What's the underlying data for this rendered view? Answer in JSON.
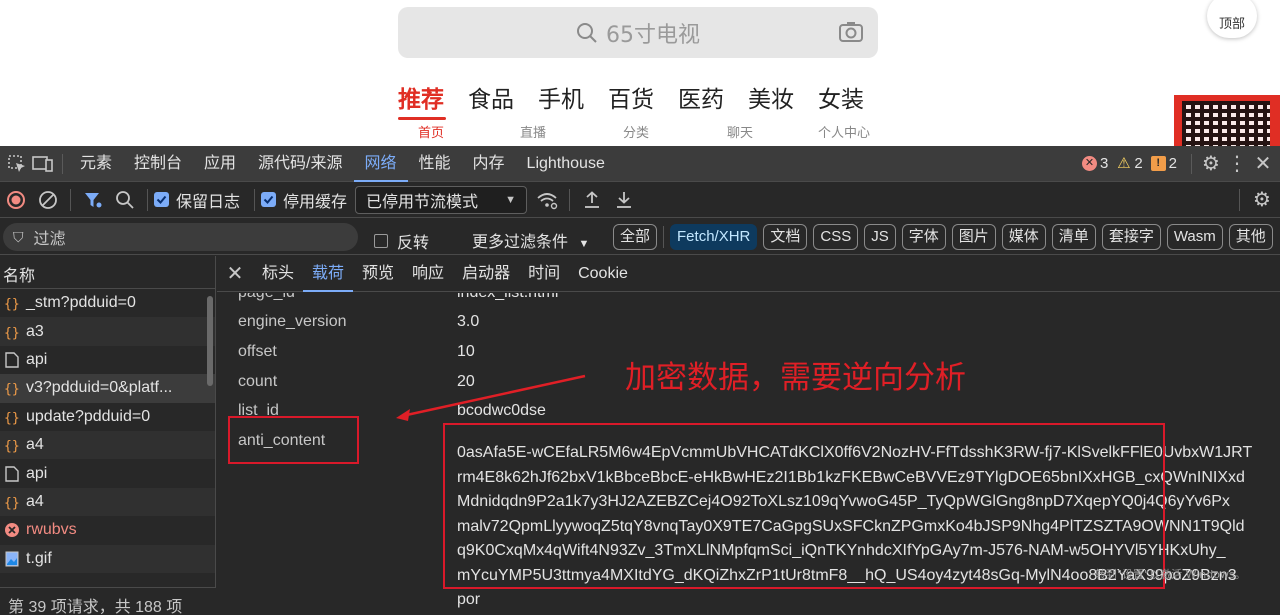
{
  "webpage": {
    "search_placeholder": "65寸电视",
    "categories": [
      "推荐",
      "食品",
      "手机",
      "百货",
      "医药",
      "美妆",
      "女装"
    ],
    "bottom_tabs": [
      "首页",
      "直播",
      "分类",
      "聊天",
      "个人中心"
    ],
    "to_top_label": "顶部"
  },
  "devtools": {
    "main_tabs": [
      "元素",
      "控制台",
      "应用",
      "源代码/来源",
      "网络",
      "性能",
      "内存",
      "Lighthouse"
    ],
    "active_main_tab": "网络",
    "errors": "3",
    "warnings": "2",
    "issues": "2",
    "preserve_log_label": "保留日志",
    "disable_cache_label": "停用缓存",
    "throttle_value": "已停用节流模式",
    "filter_placeholder": "过滤",
    "invert_label": "反转",
    "more_filters_label": "更多过滤条件",
    "type_filters": [
      "全部",
      "Fetch/XHR",
      "文档",
      "CSS",
      "JS",
      "字体",
      "图片",
      "媒体",
      "清单",
      "套接字",
      "Wasm",
      "其他"
    ],
    "active_type_filter": "Fetch/XHR",
    "colors": {
      "accent": "#7cacf8",
      "error": "#f28b82",
      "annotation_red": "#e01f26"
    }
  },
  "request_list": {
    "header": "名称",
    "items": [
      {
        "name": "_stm?pdduid=0",
        "icon": "xhr-icon"
      },
      {
        "name": "a3",
        "icon": "xhr-icon"
      },
      {
        "name": "api",
        "icon": "document-icon"
      },
      {
        "name": "v3?pdduid=0&platf...",
        "icon": "xhr-icon"
      },
      {
        "name": "update?pdduid=0",
        "icon": "xhr-icon"
      },
      {
        "name": "a4",
        "icon": "xhr-icon"
      },
      {
        "name": "api",
        "icon": "document-icon"
      },
      {
        "name": "a4",
        "icon": "xhr-icon"
      },
      {
        "name": "rwubvs",
        "icon": "error-icon"
      },
      {
        "name": "t.gif",
        "icon": "image-icon"
      }
    ],
    "footer": "第 39 项请求，共 188 项"
  },
  "detail": {
    "tabs": [
      "标头",
      "载荷",
      "预览",
      "响应",
      "启动器",
      "时间",
      "Cookie"
    ],
    "active_tab": "载荷",
    "params": [
      {
        "key": "page_id",
        "value": "index_list.html"
      },
      {
        "key": "engine_version",
        "value": "3.0"
      },
      {
        "key": "offset",
        "value": "10"
      },
      {
        "key": "count",
        "value": "20"
      },
      {
        "key": "list_id",
        "value": "bcodwc0dse"
      }
    ],
    "anti_content_key": "anti_content",
    "anti_content_lines": [
      "0asAfa5E-wCEfaLR5M6w4EpVcmmUbVHCATdKClX0ff6V2NozHV-FfTdsshK3RW-fj7-KlSvelkFFlE0UvbxW1JRT",
      "rm4E8k62hJf62bxV1kBbceBbcE-eHkBwHEz2I1Bb1kzFKEBwCeBVVEz9TYlgDOE65bnIXxHGB_cxQWnINIXxd",
      "Mdnidqdn9P2a1k7y3HJ2AZEBZCej4O92ToXLsz109qYvwoG45P_TyQpWGlGng8npD7XqepYQ0j4Q6yYv6Px",
      "malv72QpmLlyywoqZ5tqY8vnqTay0X9TE7CaGpgSUxSFCknZPGmxKo4bJSP9Nhg4PlTZSZTA9OWNN1T9Qld",
      "q9K0CxqMx4qWift4N93Zv_3TmXLlNMpfqmSci_iQnTKYnhdcXIfYpGAy7m-J576-NAM-w5OHYVl5YHKxUhy_",
      "mYcuYMP5U3ttmya4MXItdYG_dKQiZhxZrP1tUr8tmF8__hQ_US4oy4zyt48sGq-MylN4oo8B2YaX99poZ9Bzn3",
      "por"
    ]
  },
  "annotation": "加密数据，需要逆向分析",
  "watermark": [
    "转到\"设置\"以激活 Windows。"
  ]
}
